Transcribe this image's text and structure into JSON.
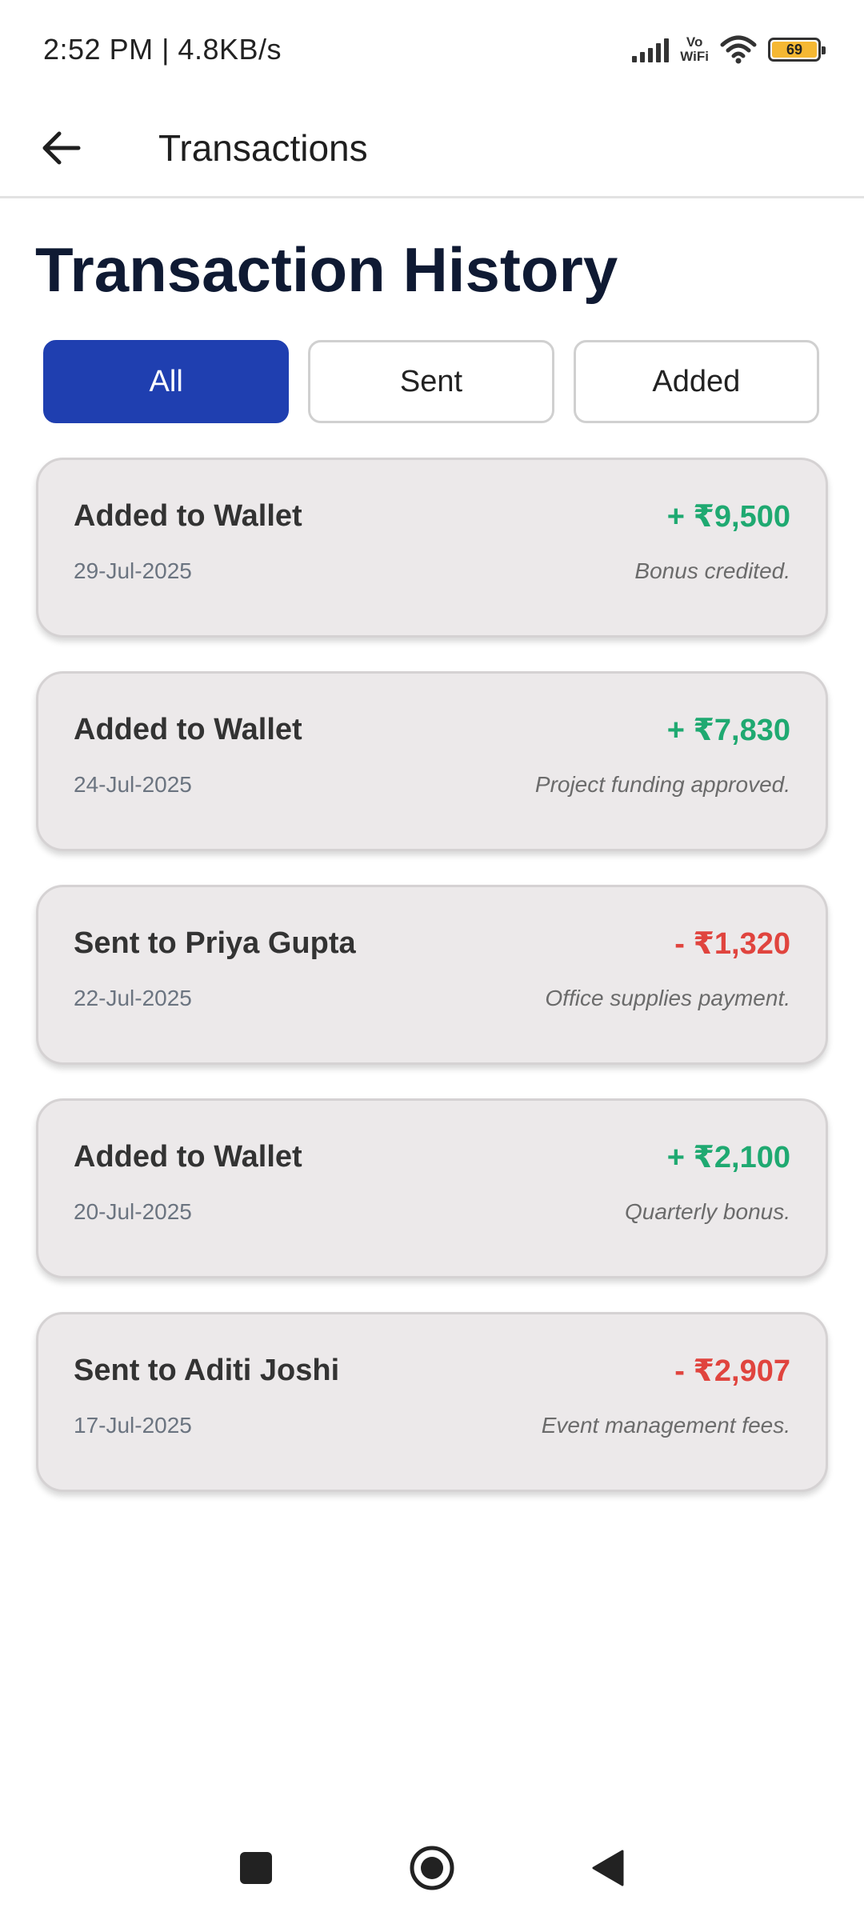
{
  "status_bar": {
    "time_speed": "2:52 PM | 4.8KB/s",
    "vowifi_top": "Vo",
    "vowifi_bottom": "WiFi",
    "battery": "69"
  },
  "app_bar": {
    "title": "Transactions",
    "back_icon": "arrow-left-icon"
  },
  "page": {
    "title": "Transaction History"
  },
  "filters": [
    {
      "label": "All",
      "active": true
    },
    {
      "label": "Sent",
      "active": false
    },
    {
      "label": "Added",
      "active": false
    }
  ],
  "transactions": [
    {
      "title": "Added to Wallet",
      "amount": "+ ₹9,500",
      "type": "credit",
      "date": "29-Jul-2025",
      "note": "Bonus credited."
    },
    {
      "title": "Added to Wallet",
      "amount": "+ ₹7,830",
      "type": "credit",
      "date": "24-Jul-2025",
      "note": "Project funding approved."
    },
    {
      "title": "Sent to Priya Gupta",
      "amount": "- ₹1,320",
      "type": "debit",
      "date": "22-Jul-2025",
      "note": "Office supplies payment."
    },
    {
      "title": "Added to Wallet",
      "amount": "+ ₹2,100",
      "type": "credit",
      "date": "20-Jul-2025",
      "note": "Quarterly bonus."
    },
    {
      "title": "Sent to Aditi Joshi",
      "amount": "- ₹2,907",
      "type": "debit",
      "date": "17-Jul-2025",
      "note": "Event management fees."
    }
  ],
  "colors": {
    "accent": "#1f3fb0",
    "credit": "#1fa971",
    "debit": "#e0443e",
    "card_bg": "#ece9ea",
    "title_dark": "#0f1a33"
  },
  "nav": {
    "recents_icon": "square-recents-icon",
    "home_icon": "circle-home-icon",
    "back_icon": "triangle-back-icon"
  }
}
